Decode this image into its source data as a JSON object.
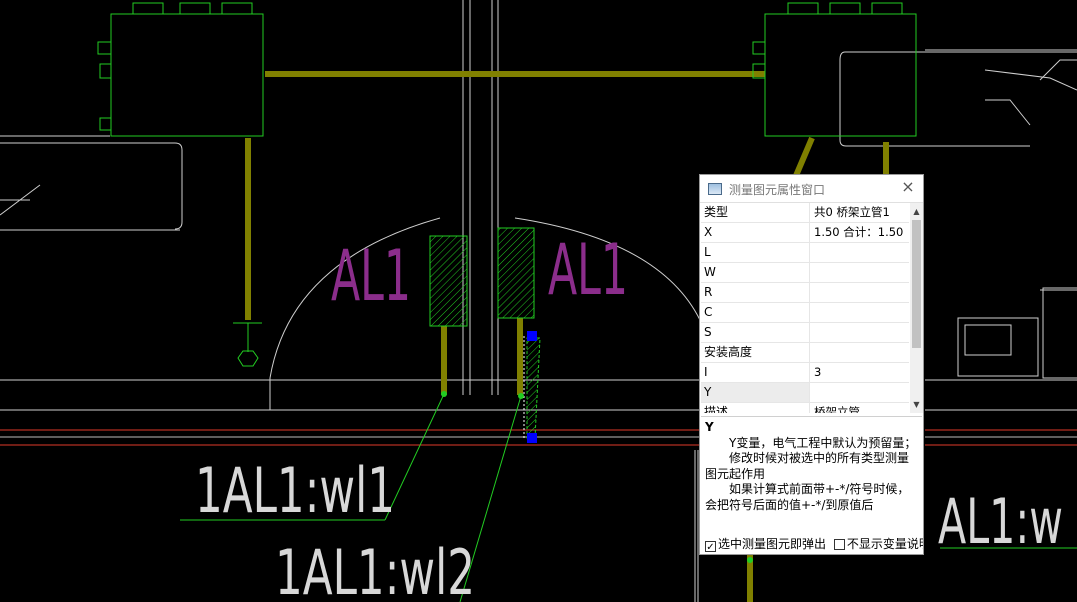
{
  "canvas": {
    "labels": {
      "al1_left": "AL1",
      "al1_right": "AL1",
      "wl1": "1AL1:wl1",
      "wl2": "1AL1:wl2",
      "right_partial": "AL1:w"
    },
    "colors": {
      "background": "#000000",
      "tray": "#808000",
      "equipment": "#22cc22",
      "lines_gray": "#c8c8c8",
      "magenta_text": "#8b2d8b",
      "red_lines": "#e03a2a",
      "selected_grip": "#0000ff"
    }
  },
  "property_window": {
    "title": "测量图元属性窗口",
    "close_icon": "×",
    "rows": [
      {
        "name": "类型",
        "value": "共0 桥架立管1"
      },
      {
        "name": "X",
        "value": "1.50  合计：1.50"
      },
      {
        "name": "L",
        "value": ""
      },
      {
        "name": "W",
        "value": ""
      },
      {
        "name": "R",
        "value": ""
      },
      {
        "name": "C",
        "value": ""
      },
      {
        "name": "S",
        "value": ""
      },
      {
        "name": "安装高度",
        "value": ""
      },
      {
        "name": "I",
        "value": "3"
      },
      {
        "name": "Y",
        "value": ""
      },
      {
        "name": "描述",
        "value": "桥架立管"
      }
    ],
    "description": {
      "title": "Y",
      "line1": "Y变量，电气工程中默认为预留量；",
      "line2": "修改时候对被选中的所有类型测量图元起作用",
      "line3": "如果计算式前面带+-*/符号时候，会把符号后面的值+-*/到原值后"
    },
    "footer": {
      "popup_label": "选中测量图元即弹出",
      "popup_checked": true,
      "hide_desc_label": "不显示变量说明",
      "hide_desc_checked": false
    }
  }
}
